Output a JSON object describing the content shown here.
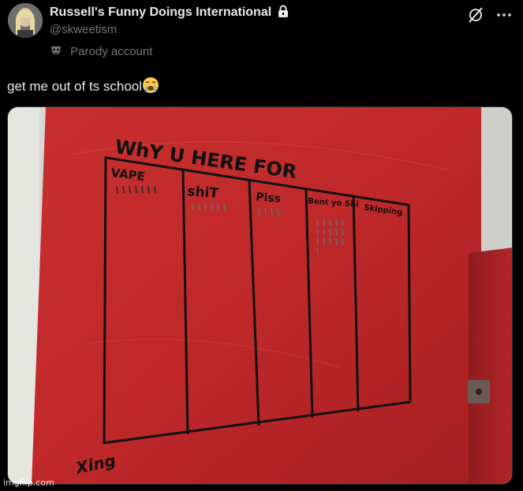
{
  "post": {
    "author": {
      "display_name": "Russell's Funny Doings International",
      "handle": "@skweetism",
      "label": "Parody account"
    },
    "text": "get me out of ts school",
    "emoji": "loudly-crying-face"
  },
  "photo": {
    "title": "WhY U HERE FOR",
    "columns": [
      "VAPE",
      "shiT",
      "Piss",
      "Bent yo Shi",
      "Skipping"
    ],
    "tally_counts": [
      7,
      6,
      4,
      16,
      0
    ],
    "signature": "Xing"
  },
  "watermark": "imgflip.com",
  "colors": {
    "background": "#000000",
    "text_primary": "#e7e9ea",
    "text_secondary": "#71767b",
    "wall_red": "#c1282b"
  },
  "icons": [
    "lock-icon",
    "parody-mask-icon",
    "grok-icon",
    "more-icon"
  ]
}
